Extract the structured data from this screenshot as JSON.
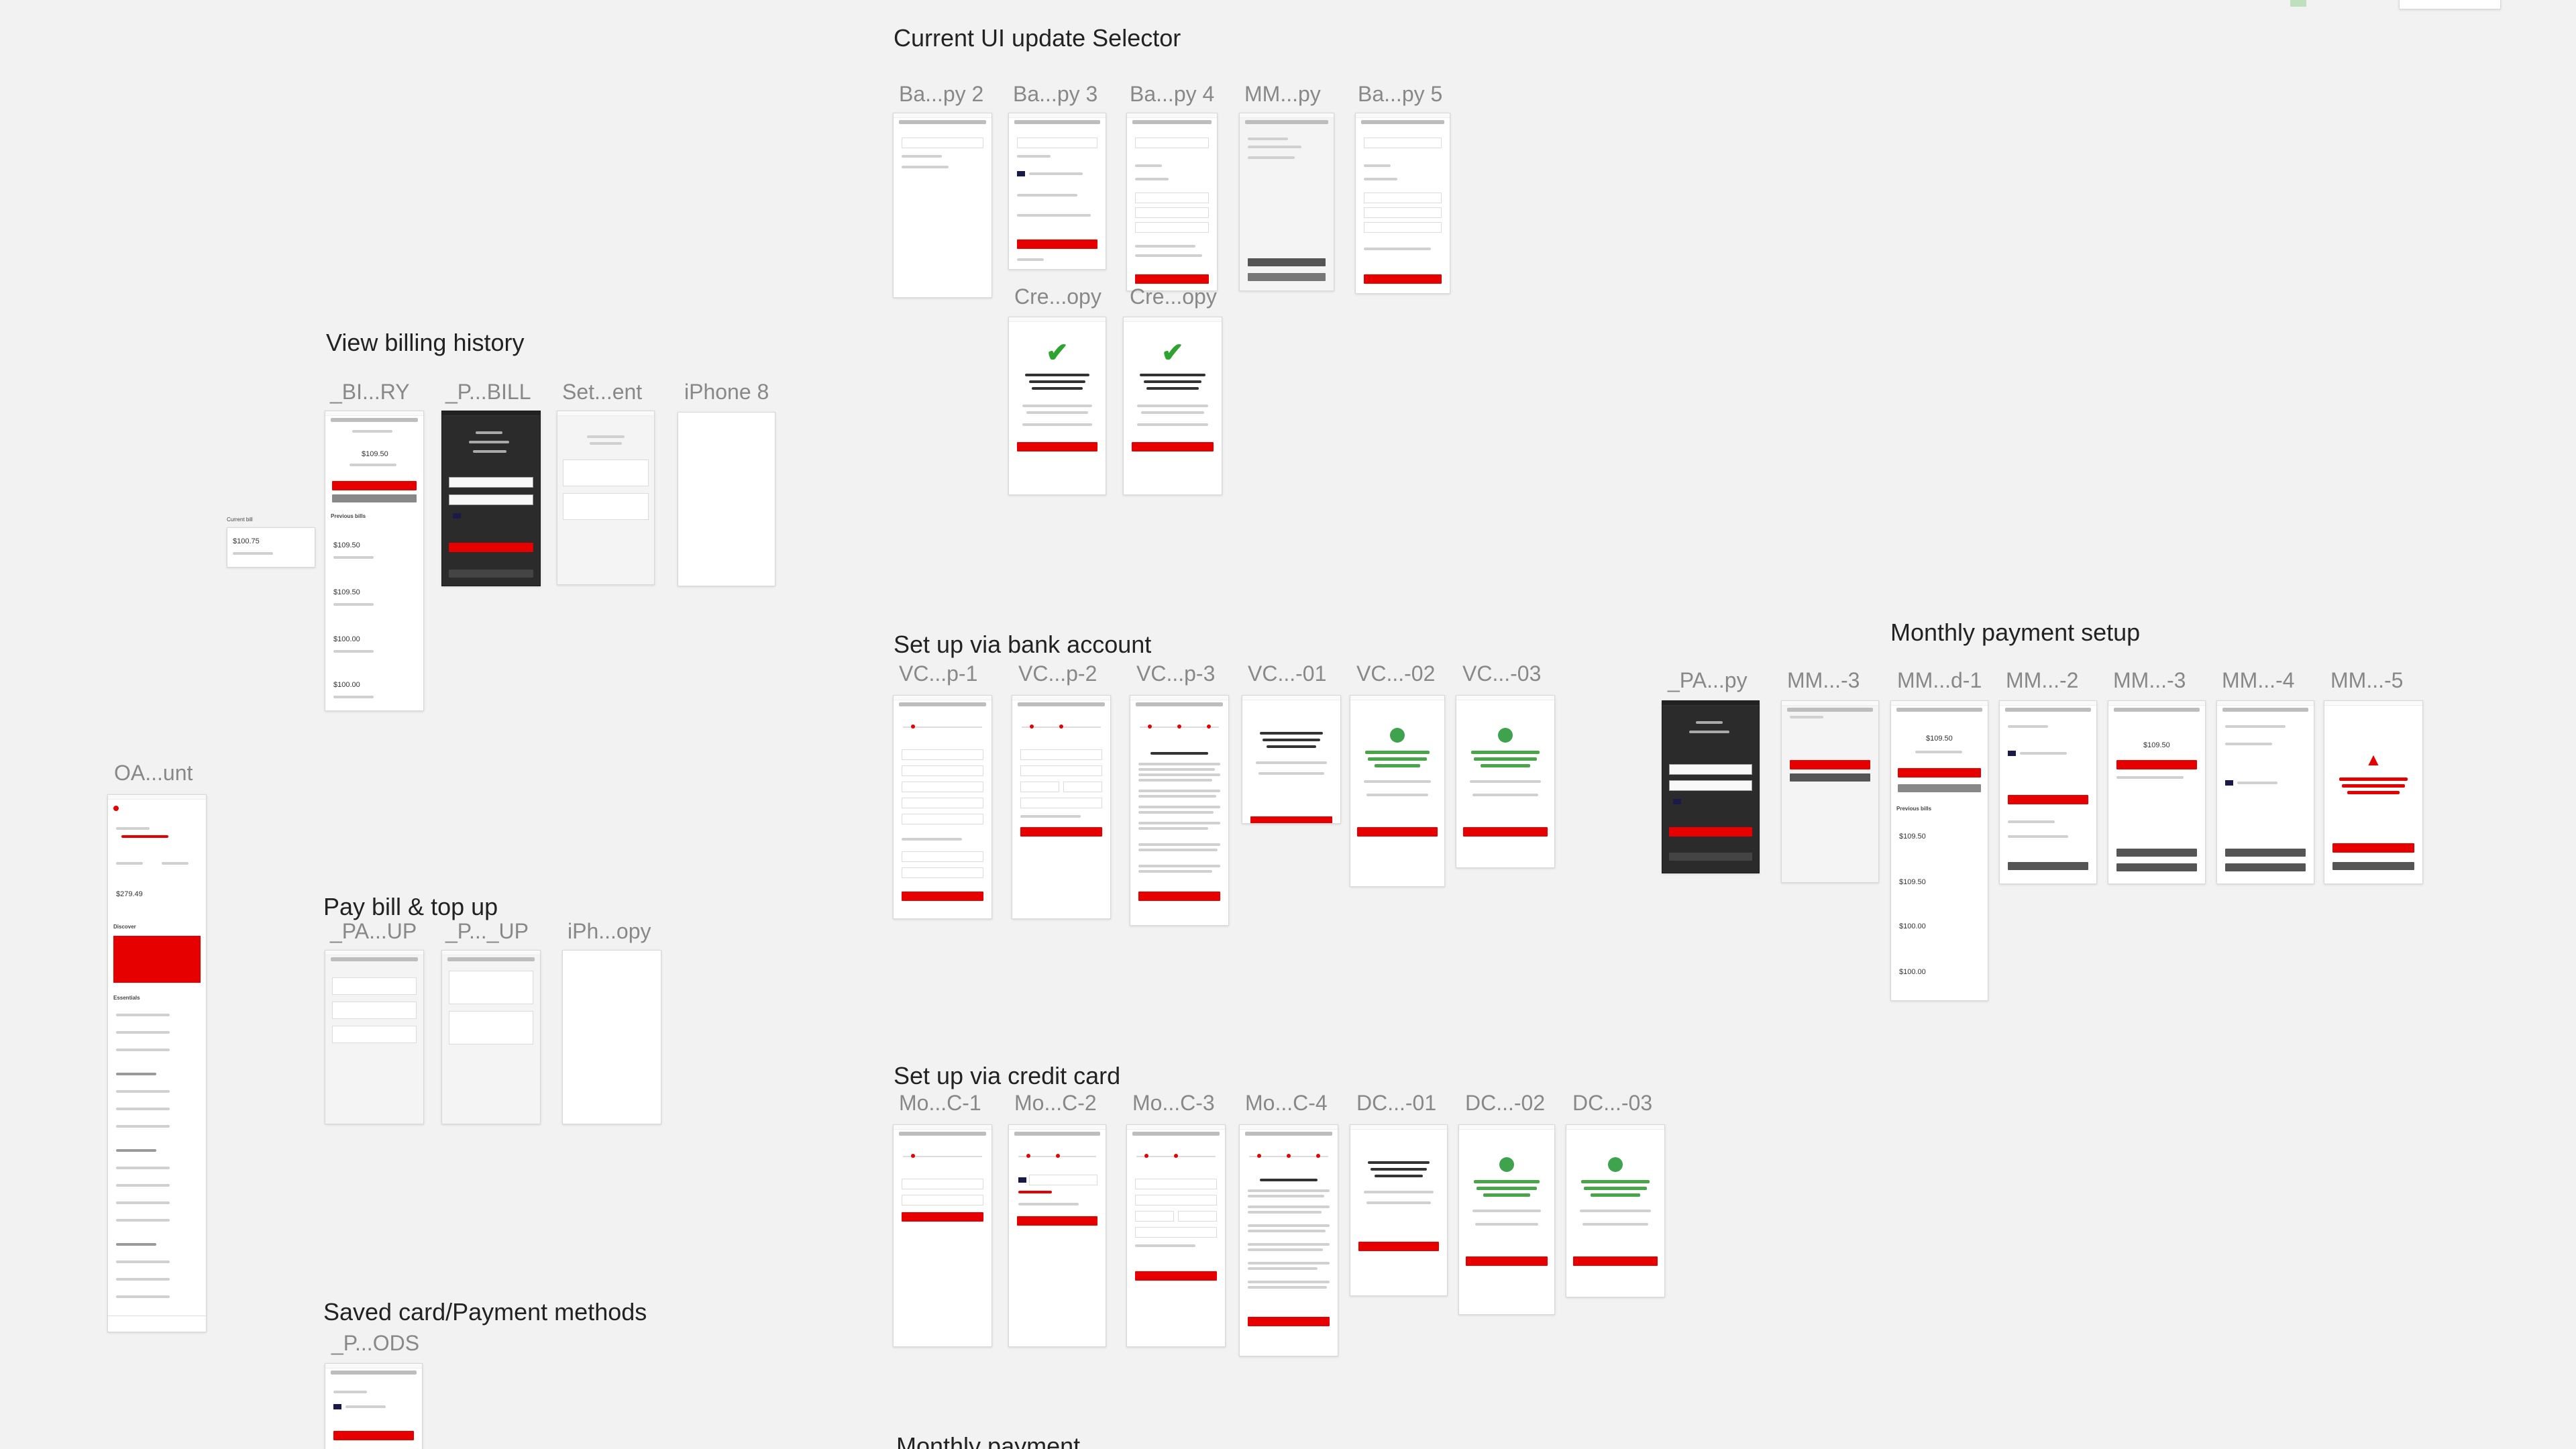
{
  "sections": {
    "current_ui": "Current UI update Selector",
    "view_billing": "View billing history",
    "pay_bill": "Pay bill & top up",
    "saved_card": "Saved card/Payment methods",
    "bank_account": "Set up via bank account",
    "credit_card": "Set up via credit card",
    "monthly_setup": "Monthly payment setup",
    "monthly_payment": "Monthly payment"
  },
  "frames": {
    "ba_py2": "Ba...py 2",
    "ba_py3": "Ba...py 3",
    "ba_py4": "Ba...py 4",
    "mm_py": "MM...py",
    "ba_py5": "Ba...py 5",
    "cre_opy_1": "Cre...opy",
    "cre_opy_2": "Cre...opy",
    "bi_ry": "_BI...RY",
    "p_bill": "_P...BILL",
    "set_ent": "Set...ent",
    "iphone8": "iPhone 8",
    "oa_unt": "OA...unt",
    "pa_up": "_PA...UP",
    "p_up": "_P..._UP",
    "iph_opy": "iPh...opy",
    "p_ods": "_P...ODS",
    "vc_p1": "VC...p-1",
    "vc_p2": "VC...p-2",
    "vc_p3": "VC...p-3",
    "vc_01": "VC...-01",
    "vc_02": "VC...-02",
    "vc_03": "VC...-03",
    "mo_c1": "Mo...C-1",
    "mo_c2": "Mo...C-2",
    "mo_c3": "Mo...C-3",
    "mo_c4": "Mo...C-4",
    "dc_01": "DC...-01",
    "dc_02": "DC...-02",
    "dc_03": "DC...-03",
    "pa_py": "_PA...py",
    "mm_3a": "MM...-3",
    "mm_d1": "MM...d-1",
    "mm_2": "MM...-2",
    "mm_3b": "MM...-3",
    "mm_4": "MM...-4",
    "mm_5": "MM...-5"
  },
  "snippets": {
    "current_bill": "Current bill",
    "amount_main": "$109.50",
    "amount_prev1": "$109.50",
    "amount_prev2": "$100.00",
    "amount_prev3": "$100.00",
    "amount_oa": "$279.49",
    "amount_side": "$100.75",
    "previous_bills": "Previous bills",
    "discover": "Discover",
    "essentials": "Essentials"
  },
  "colors": {
    "brand_red": "#e60000",
    "success_green": "#3fa34d",
    "canvas_bg": "#f2f2f2"
  }
}
